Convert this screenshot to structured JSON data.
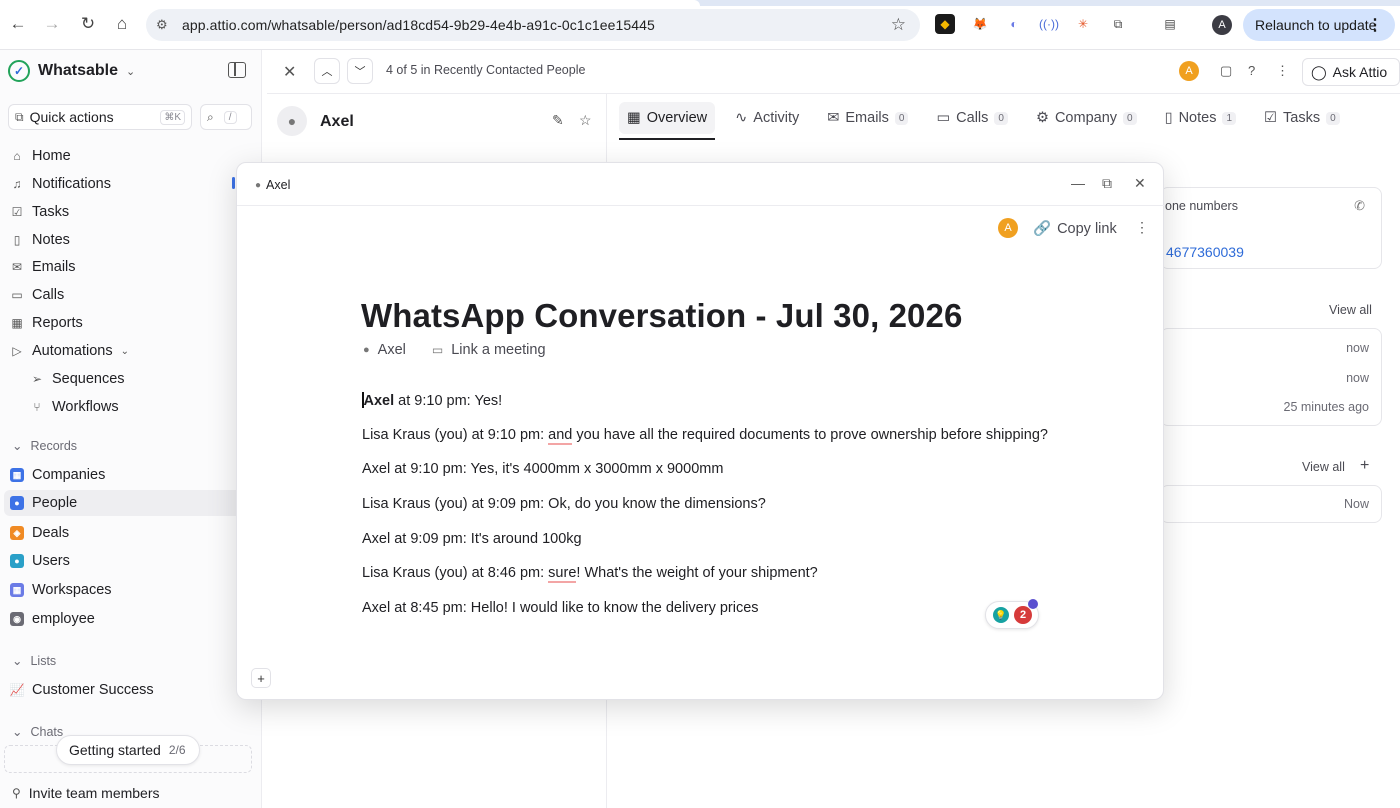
{
  "browser": {
    "url": "app.attio.com/whatsable/person/ad18cd54-9b29-4e4b-a91c-0c1c1ee15445",
    "profile_initial": "A",
    "relaunch_label": "Relaunch to update"
  },
  "sidebar": {
    "workspace_name": "Whatsable",
    "quick_actions_label": "Quick actions",
    "quick_actions_kbd": "⌘K",
    "search_kbd": "/",
    "nav": [
      {
        "label": "Home",
        "icon": "home-icon"
      },
      {
        "label": "Notifications",
        "icon": "bell-icon"
      },
      {
        "label": "Tasks",
        "icon": "checkbox-icon"
      },
      {
        "label": "Notes",
        "icon": "document-icon"
      },
      {
        "label": "Emails",
        "icon": "mail-icon"
      },
      {
        "label": "Calls",
        "icon": "video-icon"
      },
      {
        "label": "Reports",
        "icon": "chart-icon"
      },
      {
        "label": "Automations",
        "icon": "play-icon"
      }
    ],
    "automation_items": [
      {
        "label": "Sequences",
        "icon": "send-icon"
      },
      {
        "label": "Workflows",
        "icon": "workflow-icon"
      }
    ],
    "records_label": "Records",
    "records": [
      {
        "label": "Companies",
        "color": "#3d72e6"
      },
      {
        "label": "People",
        "color": "#3d72e6"
      },
      {
        "label": "Deals",
        "color": "#f08a24"
      },
      {
        "label": "Users",
        "color": "#2aa0c8"
      },
      {
        "label": "Workspaces",
        "color": "#6b7be6"
      },
      {
        "label": "employee",
        "color": "#6b6b74"
      }
    ],
    "lists_label": "Lists",
    "lists": [
      {
        "label": "Customer Success"
      }
    ],
    "chats_label": "Chats",
    "getting_started_label": "Getting started",
    "getting_started_count": "2/6",
    "invite_label": "Invite team members"
  },
  "record": {
    "position_text": "4 of 5 in Recently Contacted People",
    "avatar_initial": "A",
    "ask_label": "Ask Attio",
    "name": "Axel",
    "tabs": [
      {
        "label": "Overview",
        "count": ""
      },
      {
        "label": "Activity",
        "count": ""
      },
      {
        "label": "Emails",
        "count": "0"
      },
      {
        "label": "Calls",
        "count": "0"
      },
      {
        "label": "Company",
        "count": "0"
      },
      {
        "label": "Notes",
        "count": "1"
      },
      {
        "label": "Tasks",
        "count": "0"
      }
    ],
    "phone_label": "one numbers",
    "phone_value": "4677360039",
    "view_all_1": "View all",
    "view_all_2": "View all",
    "activity_times": [
      "now",
      "now",
      "25 minutes ago"
    ],
    "task_time": "Now"
  },
  "modal": {
    "header_title": "Axel",
    "avatar_initial": "A",
    "copy_link_label": "Copy link",
    "title": "WhatsApp Conversation - Jul 30, 2026",
    "meta_person": "Axel",
    "meta_meeting": "Link a meeting",
    "lines": {
      "l1_name": "Axel",
      "l1_rest": " at 9:10 pm: Yes!",
      "l2_a": "Lisa Kraus (you) at 9:10 pm: ",
      "l2_u": "and",
      "l2_b": " you have all the required documents to prove ownership before shipping?",
      "l3": "Axel at 9:10 pm: Yes, it's 4000mm x 3000mm x 9000mm",
      "l4": "Lisa Kraus (you) at 9:09 pm: Ok, do you know the dimensions?",
      "l5": "Axel at 9:09 pm: It's around 100kg",
      "l6_a": "Lisa Kraus (you) at 8:46 pm: ",
      "l6_u": "sure",
      "l6_b": "! What's the weight of your shipment?",
      "l7": "Axel at 8:45 pm: Hello! I would like to know the delivery prices"
    },
    "grammar_count": "2"
  }
}
